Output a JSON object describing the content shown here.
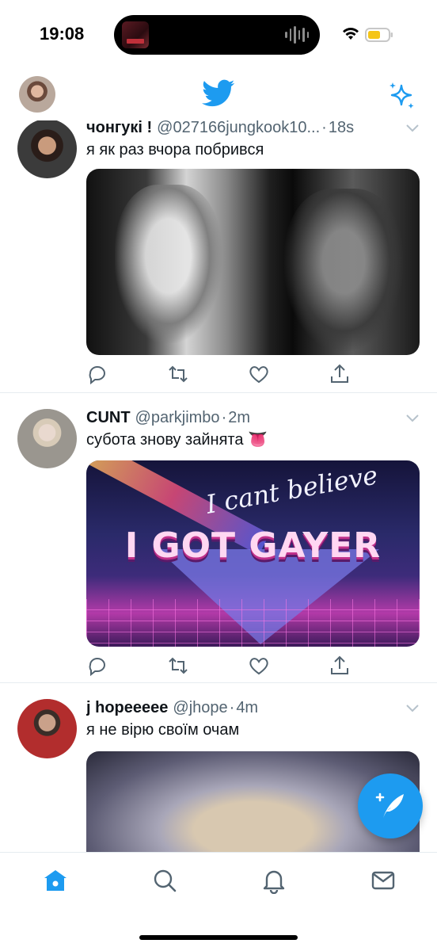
{
  "status_bar": {
    "time": "19:08",
    "icons": [
      "now-playing-artwork",
      "audio-waveform-icon",
      "wifi-icon",
      "battery-icon"
    ],
    "battery_color": "#f5c518"
  },
  "top_nav": {
    "icons": [
      "profile-avatar",
      "twitter-bird-icon",
      "sparkle-icon"
    ],
    "accent_color": "#1d9bf0"
  },
  "tweets": [
    {
      "display_name": "чонгукі !",
      "handle": "@027166jungkook10...",
      "age": "18s",
      "text": "я як раз вчора побрився",
      "media": "black-and-white-image"
    },
    {
      "display_name": "CUNT",
      "handle": "@parkjimbo",
      "age": "2m",
      "text": "субота знову зайнята 👅",
      "media": "gif",
      "media_text_top": "I cant believe",
      "media_text_main": "I GOT GAYER"
    },
    {
      "display_name": "j hopeeeee",
      "handle": "@jhope",
      "age": "4m",
      "text": "я не вірю своїм очам",
      "media": "blurry-image"
    }
  ],
  "tweet_actions": [
    "reply-icon",
    "retweet-icon",
    "like-icon",
    "share-icon"
  ],
  "compose": {
    "icon": "compose-feather-icon"
  },
  "tab_bar": {
    "tabs": [
      "home-icon",
      "search-icon",
      "notifications-icon",
      "messages-icon"
    ],
    "active": "home-icon"
  },
  "separator": "·"
}
